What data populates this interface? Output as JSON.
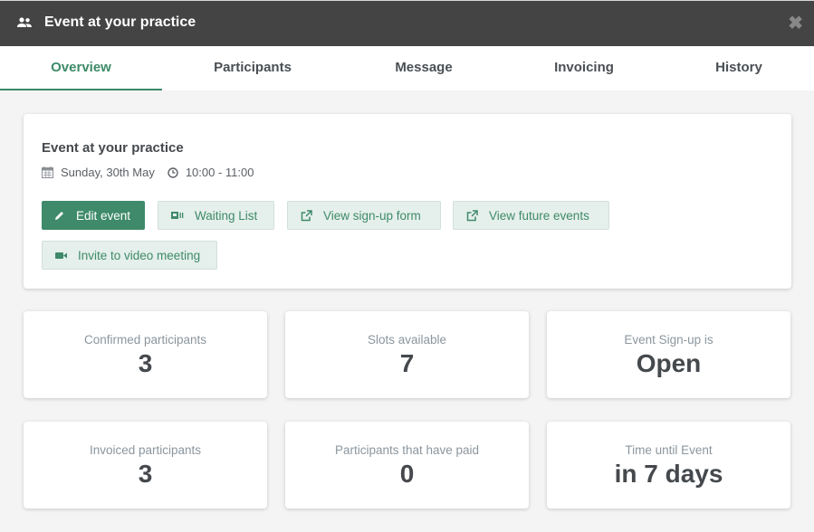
{
  "dialog": {
    "title": "Event at your practice",
    "title_icon": "people-icon",
    "close_label": "✖"
  },
  "tabs": [
    {
      "label": "Overview",
      "active": true
    },
    {
      "label": "Participants",
      "active": false
    },
    {
      "label": "Message",
      "active": false
    },
    {
      "label": "Invoicing",
      "active": false
    },
    {
      "label": "History",
      "active": false
    }
  ],
  "event": {
    "title": "Event at your practice",
    "date": "Sunday, 30th May",
    "time": "10:00 - 11:00"
  },
  "actions": {
    "edit": "Edit event",
    "waiting_list": "Waiting List",
    "view_signup": "View sign-up form",
    "view_future": "View future events",
    "invite_video": "Invite to video meeting"
  },
  "stats": [
    {
      "label": "Confirmed participants",
      "value": "3"
    },
    {
      "label": "Slots available",
      "value": "7"
    },
    {
      "label": "Event Sign-up is",
      "value": "Open"
    },
    {
      "label": "Invoiced participants",
      "value": "3"
    },
    {
      "label": "Participants that have paid",
      "value": "0"
    },
    {
      "label": "Time until Event",
      "value": "in 7 days"
    }
  ],
  "colors": {
    "accent": "#3e8a6a",
    "titlebar": "#444444",
    "light_button": "#e5efeb"
  }
}
